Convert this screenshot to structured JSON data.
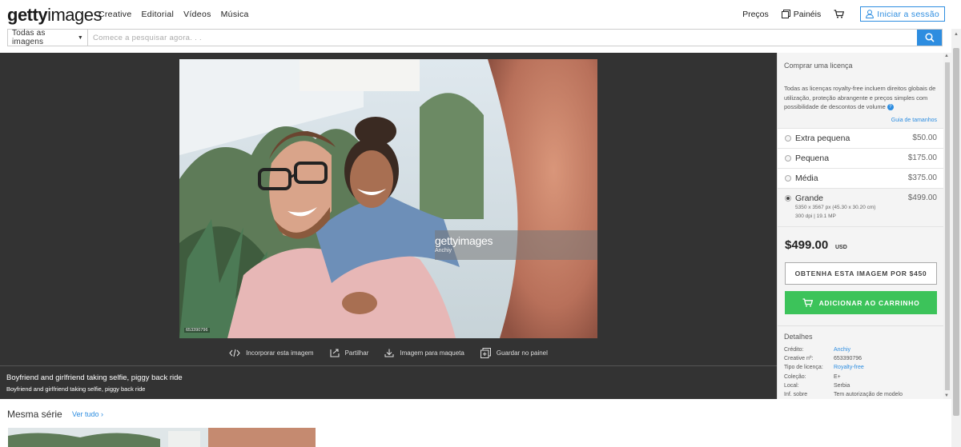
{
  "header": {
    "logo_bold": "getty",
    "logo_light": "images",
    "nav": [
      "Creative",
      "Editorial",
      "Vídeos",
      "Música"
    ],
    "pricing": "Preços",
    "boards": "Painéis",
    "cart_icon": "cart-icon",
    "signin": "Iniciar a sessão"
  },
  "search": {
    "type_label": "Todas as imagens",
    "placeholder": "Comece a pesquisar agora. . ."
  },
  "viewer": {
    "watermark_logo": "gettyimages",
    "watermark_credit": "Anchiy",
    "image_id": "653390796",
    "actions": [
      {
        "label": "Incorporar esta imagem",
        "icon": "embed-icon"
      },
      {
        "label": "Partilhar",
        "icon": "share-icon"
      },
      {
        "label": "Imagem para maqueta",
        "icon": "download-icon"
      },
      {
        "label": "Guardar no painel",
        "icon": "add-to-board-icon"
      }
    ],
    "caption_title": "Boyfriend and girlfriend taking selfie, piggy back ride",
    "caption_sub": "Boyfriend and girlfriend taking selfie, piggy back ride"
  },
  "series": {
    "title": "Mesma série",
    "view_all": "Ver tudo"
  },
  "panel": {
    "title": "Comprar uma licença",
    "description": "Todas as licenças royalty-free incluem direitos globais de utilização, proteção abrangente e preços simples com possibilidade de descontos de volume",
    "help_mark": "?",
    "size_guide": "Guia de tamanhos",
    "sizes": [
      {
        "name": "Extra pequena",
        "price": "$50.00"
      },
      {
        "name": "Pequena",
        "price": "$175.00"
      },
      {
        "name": "Média",
        "price": "$375.00"
      },
      {
        "name": "Grande",
        "price": "$499.00",
        "dimensions": "5350 x 3567 px (45.30 x 30.20 cm)",
        "dpi": "300 dpi | 19.1 MP"
      }
    ],
    "selected_size": "Grande",
    "total_price": "$499.00",
    "currency": "USD",
    "get_button": "OBTENHA ESTA IMAGEM POR $450",
    "cart_button": "ADICIONAR AO CARRINHO",
    "details_title": "Detalhes",
    "details": [
      {
        "key": "Crédito:",
        "value": "Anchiy",
        "link": true
      },
      {
        "key": "Creative nº:",
        "value": "653390796",
        "link": false
      },
      {
        "key": "Tipo de licença:",
        "value": "Royalty-free",
        "link": true
      },
      {
        "key": "Coleção:",
        "value": "E+",
        "link": false
      },
      {
        "key": "Local:",
        "value": "Serbia",
        "link": false
      },
      {
        "key": "Inf. sobre",
        "value": "Tem autorização de modelo",
        "link": false
      }
    ]
  },
  "colors": {
    "accent": "#2d8de0",
    "cart_green": "#3cc35a",
    "viewer_bg": "#333333"
  }
}
